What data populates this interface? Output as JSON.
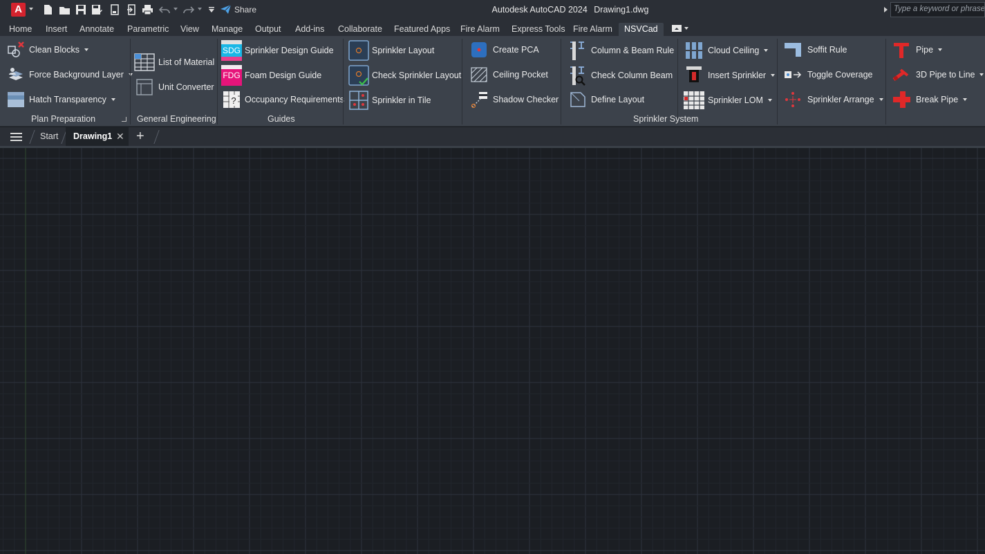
{
  "titlebar": {
    "app_logo": "A",
    "share_label": "Share",
    "app_name": "Autodesk AutoCAD 2024",
    "document_name": "Drawing1.dwg",
    "search_placeholder": "Type a keyword or phrase"
  },
  "ribbon_tabs": [
    "Home",
    "Insert",
    "Annotate",
    "Parametric",
    "View",
    "Manage",
    "Output",
    "Add-ins",
    "Collaborate",
    "Featured Apps",
    "Fire Alarm",
    "Express Tools",
    "Fire Alarm",
    "NSVCad"
  ],
  "active_tab": "NSVCad",
  "panels": {
    "plan_preparation": {
      "title": "Plan Preparation",
      "items": [
        "Clean Blocks",
        "Force Background Layer",
        "Hatch Transparency"
      ]
    },
    "general_engineering": {
      "title": "General Engineering",
      "items": [
        "List of Material",
        "Unit Converter"
      ]
    },
    "guides": {
      "title": "Guides",
      "items": [
        "Sprinkler Design Guide",
        "Foam Design Guide",
        "Occupancy Requirements"
      ],
      "icon_text": [
        "SDG",
        "FDG"
      ]
    },
    "sprinkler_system": {
      "title": "Sprinkler System",
      "col1": [
        "Sprinkler Layout",
        "Check Sprinkler Layout",
        "Sprinkler in Tile"
      ],
      "col2": [
        "Create PCA",
        "Ceiling Pocket",
        "Shadow Checker"
      ],
      "col3": [
        "Column & Beam Rule",
        "Check Column  Beam",
        "Define Layout"
      ],
      "col4": [
        "Cloud Ceiling",
        "Insert Sprinkler",
        "Sprinkler LOM"
      ],
      "col5": [
        "Soffit Rule",
        "Toggle Coverage",
        "Sprinkler Arrange"
      ],
      "col6": [
        "Pipe",
        "3D Pipe to Line",
        "Break Pipe"
      ]
    }
  },
  "file_tabs": {
    "start": "Start",
    "active": "Drawing1",
    "close_glyph": "✕",
    "add_glyph": "+"
  },
  "colors": {
    "canvas_bg": "#1b1e23",
    "ribbon_bg": "#3c424b",
    "titlebar_bg": "#2b2f36",
    "accent_red": "#d4232e",
    "accent_blue": "#2f8fd8"
  }
}
